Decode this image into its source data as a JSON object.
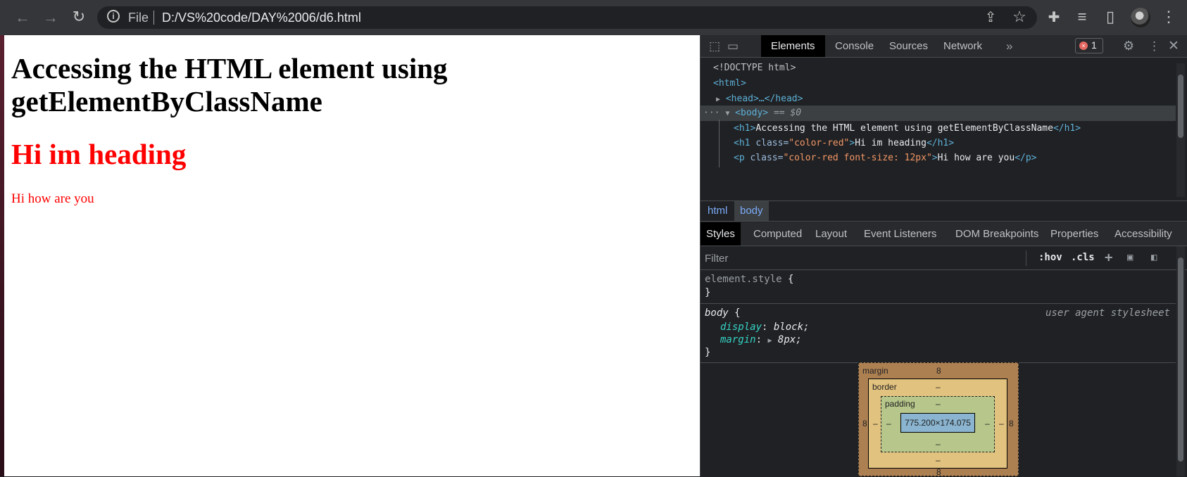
{
  "browser": {
    "nav": {
      "back_icon": "←",
      "forward_icon": "→",
      "reload_icon": "↻"
    },
    "omnibox": {
      "scheme_label": "File",
      "url": "D:/VS%20code/DAY%2006/d6.html"
    },
    "actions": {
      "share_icon": "⇪",
      "bookmark_icon": "☆",
      "extensions_icon": "✚",
      "media_icon": "≡",
      "sidepanel_icon": "▯",
      "menu_icon": "⋮"
    }
  },
  "page": {
    "heading": "Accessing the HTML element using getElementByClassName",
    "heading_red": "Hi im heading",
    "paragraph": "Hi how are you"
  },
  "devtools": {
    "tabs": [
      "Elements",
      "Console",
      "Sources",
      "Network"
    ],
    "more_tabs": "»",
    "error_count": "1",
    "dom": {
      "doctype": "<!DOCTYPE html>",
      "html_open": "<html>",
      "head": "<head>…</head>",
      "body_open": "<body>",
      "body_marker": "== $0",
      "line1_tag_open": "<h1>",
      "line1_text": "Accessing the HTML element using getElementByClassName",
      "line1_tag_close": "</h1>",
      "line2_tag_open": "<h1 ",
      "line2_attr": "class=",
      "line2_value": "\"color-red\"",
      "line2_text": "Hi im heading",
      "line2_tag_close": "</h1>",
      "line3_tag_open": "<p ",
      "line3_attr": "class=",
      "line3_value": "\"color-red font-size: 12px\"",
      "line3_text": "Hi how are you",
      "line3_tag_close": "</p>"
    },
    "breadcrumbs": [
      "html",
      "body"
    ],
    "style_tabs": [
      "Styles",
      "Computed",
      "Layout",
      "Event Listeners",
      "DOM Breakpoints",
      "Properties",
      "Accessibility"
    ],
    "filter": {
      "placeholder": "Filter",
      "hov": ":hov",
      "cls": ".cls",
      "plus": "+"
    },
    "rules": {
      "element_style_selector": "element.style",
      "open_brace": " {",
      "close_brace": "}",
      "body_selector": "body",
      "ua_label": "user agent stylesheet",
      "display_prop": "display",
      "display_val": "block;",
      "margin_prop": "margin",
      "margin_val": "8px;"
    },
    "box_model": {
      "margin_label": "margin",
      "margin_top": "8",
      "margin_left": "8",
      "margin_right": "8",
      "margin_bottom": "8",
      "border_label": "border",
      "border_top": "–",
      "border_left": "–",
      "border_right": "–",
      "border_bottom": "–",
      "padding_label": "padding",
      "padding_top": "–",
      "padding_left": "–",
      "padding_right": "–",
      "padding_bottom": "–",
      "content_size": "775.200×174.075"
    }
  }
}
